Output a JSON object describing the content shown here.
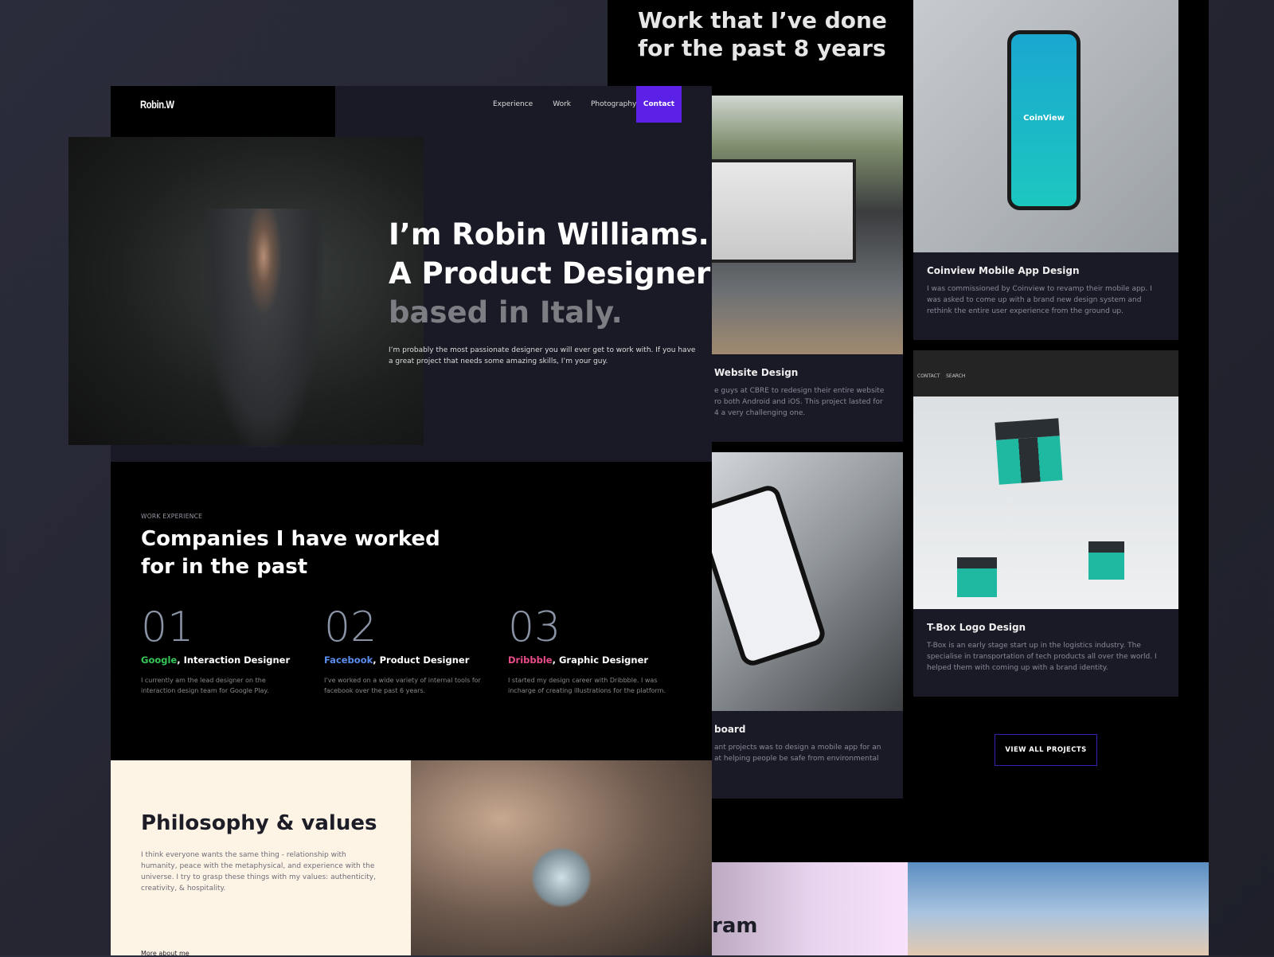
{
  "projects": {
    "title_line1": "Work that I’ve done",
    "title_line2": "for the past 8 years",
    "cards": [
      {
        "title": "Website Design",
        "desc": "e guys at CBRE to redesign their entire website ro both Android and iOS. This project lasted for 4 a very challenging one."
      },
      {
        "title": "board",
        "desc": "ant projects was to design a mobile app for an at helping people be safe from environmental"
      },
      {
        "title": "Coinview Mobile App Design",
        "desc": "I was commissioned by Coinview to revamp their mobile app. I was asked to come up with a brand new design system and rethink the entire user experience from the ground up.",
        "app_label": "CoinView"
      },
      {
        "title": "T-Box Logo Design",
        "desc": "T-Box is an early stage start up in the logistics industry. The specialise in transportation of tech products all over the world. I helped them with coming up with a brand identity.",
        "mock_nav": [
          "CONTACT",
          "SEARCH"
        ]
      }
    ],
    "view_all": "VIEW ALL PROJECTS",
    "photo_title": "ram"
  },
  "header": {
    "brand": "Robin.W",
    "nav": [
      "Experience",
      "Work",
      "Photography"
    ],
    "contact": "Contact",
    "accent": "#5b21e6"
  },
  "hero": {
    "line1": "I’m Robin Williams.",
    "line2": "A Product Designer",
    "line3": "based in Italy.",
    "text": "I’m probably the most passionate designer you will ever get to work with. If you have a great project that needs some amazing skills, I’m your guy."
  },
  "experience": {
    "label": "WORK EXPERIENCE",
    "title_line1": "Companies I have worked",
    "title_line2": "for in the past",
    "items": [
      {
        "num": "01",
        "company": "Google",
        "role": ", Interaction Designer",
        "color": "#34c759",
        "desc": "I currently am the lead designer on the interaction design team for Google Play."
      },
      {
        "num": "02",
        "company": "Facebook",
        "role": ", Product Designer",
        "color": "#5b8def",
        "desc": "I’ve worked on a wide variety of internal tools for facebook over the past 6 years."
      },
      {
        "num": "03",
        "company": "Dribbble",
        "role": ", Graphic Designer",
        "color": "#ea4c89",
        "desc": "I started my design career with Dribbble. I was incharge of creating illustrations for the platform."
      }
    ]
  },
  "philosophy": {
    "title": "Philosophy & values",
    "text": "I think everyone wants the same thing - relationship with humanity, peace with the metaphysical, and experience with the universe. I try to grasp these things with my values: authenticity, creativity, & hospitality.",
    "link": "More about me"
  }
}
